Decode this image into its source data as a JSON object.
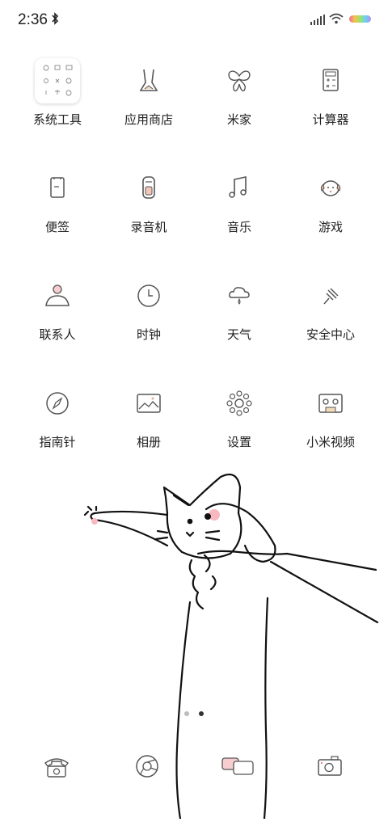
{
  "status_bar": {
    "time": "2:36",
    "icons": [
      "bluetooth-icon",
      "signal-icon",
      "wifi-icon",
      "battery-icon"
    ]
  },
  "apps": [
    {
      "label": "系统工具",
      "icon": "system-tools-folder-icon"
    },
    {
      "label": "应用商店",
      "icon": "app-store-icon"
    },
    {
      "label": "米家",
      "icon": "mijia-icon"
    },
    {
      "label": "计算器",
      "icon": "calculator-icon"
    },
    {
      "label": "便签",
      "icon": "notes-icon"
    },
    {
      "label": "录音机",
      "icon": "recorder-icon"
    },
    {
      "label": "音乐",
      "icon": "music-icon"
    },
    {
      "label": "游戏",
      "icon": "games-icon"
    },
    {
      "label": "联系人",
      "icon": "contacts-icon"
    },
    {
      "label": "时钟",
      "icon": "clock-icon"
    },
    {
      "label": "天气",
      "icon": "weather-icon"
    },
    {
      "label": "安全中心",
      "icon": "security-icon"
    },
    {
      "label": "指南针",
      "icon": "compass-icon"
    },
    {
      "label": "相册",
      "icon": "gallery-icon"
    },
    {
      "label": "设置",
      "icon": "settings-icon"
    },
    {
      "label": "小米视频",
      "icon": "video-icon"
    }
  ],
  "page_indicator": {
    "pages": 2,
    "current": 2
  },
  "dock": [
    "phone-icon",
    "browser-icon",
    "messages-icon",
    "camera-icon"
  ],
  "colors": {
    "line": "#555555",
    "paw": "#f7b9bf"
  }
}
